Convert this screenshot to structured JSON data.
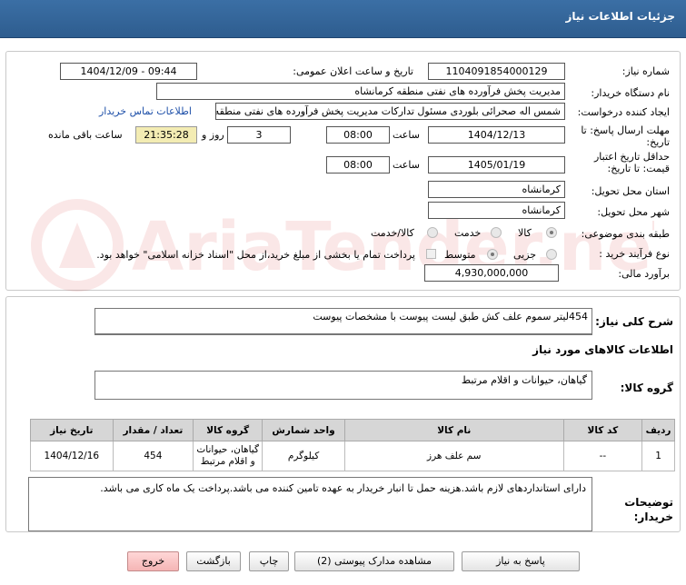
{
  "header": {
    "title": "جزئیات اطلاعات نیاز"
  },
  "form": {
    "need_number": {
      "label": "شماره نیاز:",
      "value": "1104091854000129"
    },
    "announce_datetime": {
      "label": "تاریخ و ساعت اعلان عمومی:",
      "value": "1404/12/09 - 09:44"
    },
    "buyer_org": {
      "label": "نام دستگاه خریدار:",
      "value": "مدیریت پخش فرآورده های نفتی منطقه کرمانشاه"
    },
    "requester": {
      "label": "ایجاد کننده درخواست:",
      "value": "شمس اله صحرائی بلوردی مسئول تدارکات  مدیریت پخش فرآورده های نفتی منطقه",
      "contact_link": "اطلاعات تماس خریدار"
    },
    "reply_deadline": {
      "label": "مهلت ارسال پاسخ: تا تاریخ:",
      "date": "1404/12/13",
      "time_label": "ساعت",
      "time": "08:00",
      "days": "3",
      "days_label": "روز و",
      "remaining": "21:35:28",
      "remaining_label": "ساعت باقی مانده"
    },
    "price_validity": {
      "label": "حداقل تاریخ اعتبار قیمت: تا تاریخ:",
      "date": "1405/01/19",
      "time_label": "ساعت",
      "time": "08:00"
    },
    "delivery_province": {
      "label": "استان محل تحویل:",
      "value": "کرمانشاه"
    },
    "delivery_city": {
      "label": "شهر محل تحویل:",
      "value": "کرمانشاه"
    },
    "category": {
      "label": "طبقه بندی موضوعی:",
      "options": [
        "کالا",
        "خدمت",
        "کالا/خدمت"
      ],
      "selected": "کالا"
    },
    "purchase_type": {
      "label": "نوع فرآیند خرید :",
      "options": [
        "جزیی",
        "متوسط"
      ],
      "selected": "متوسط",
      "note": "پرداخت تمام یا بخشی از مبلغ خرید،از محل \"اسناد خزانه اسلامی\" خواهد بود."
    },
    "budget": {
      "label": "برآورد مالی:",
      "value": "4,930,000,000"
    }
  },
  "description": {
    "label": "شرح کلی نیاز:",
    "value": "454لیتر سموم علف کش طبق لیست پیوست با مشخصات پیوست"
  },
  "goods_section": {
    "title": "اطلاعات کالاهای مورد نیاز",
    "group_label": "گروه کالا:",
    "group_value": "گیاهان، حیوانات و اقلام مرتبط"
  },
  "table": {
    "headers": [
      "ردیف",
      "کد کالا",
      "نام کالا",
      "واحد شمارش",
      "گروه کالا",
      "تعداد / مقدار",
      "تاریخ نیاز"
    ],
    "rows": [
      [
        "1",
        "--",
        "سم علف هرز",
        "کیلوگرم",
        "گیاهان، حیوانات و اقلام مرتبط",
        "454",
        "1404/12/16"
      ]
    ]
  },
  "buyer_notes": {
    "label": "توضیحات خریدار:",
    "value": "دارای استانداردهای لازم باشد.هزینه حمل تا انبار خریدار به عهده تامین کننده می باشد.پرداخت یک ماه کاری می باشد."
  },
  "buttons": {
    "reply": "پاسخ به نیاز",
    "attachments": "مشاهده مدارک پیوستی (2)",
    "print": "چاپ",
    "back": "بازگشت",
    "exit": "خروج"
  },
  "watermark": "AriaTender.neT",
  "colors": {
    "header_bg": "#2e5d8f",
    "time_bg": "#f3ecb3",
    "link": "#1d4fa8",
    "exit_bg": "#f5b5b5"
  }
}
